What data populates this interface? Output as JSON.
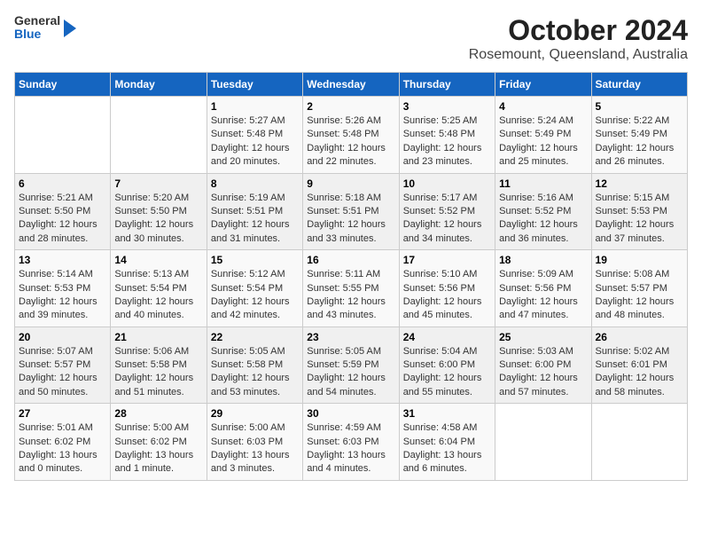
{
  "header": {
    "logo": {
      "general": "General",
      "blue": "Blue"
    },
    "title": "October 2024",
    "subtitle": "Rosemount, Queensland, Australia"
  },
  "weekdays": [
    "Sunday",
    "Monday",
    "Tuesday",
    "Wednesday",
    "Thursday",
    "Friday",
    "Saturday"
  ],
  "weeks": [
    [
      {
        "day": "",
        "info": ""
      },
      {
        "day": "",
        "info": ""
      },
      {
        "day": "1",
        "info": "Sunrise: 5:27 AM\nSunset: 5:48 PM\nDaylight: 12 hours and 20 minutes."
      },
      {
        "day": "2",
        "info": "Sunrise: 5:26 AM\nSunset: 5:48 PM\nDaylight: 12 hours and 22 minutes."
      },
      {
        "day": "3",
        "info": "Sunrise: 5:25 AM\nSunset: 5:48 PM\nDaylight: 12 hours and 23 minutes."
      },
      {
        "day": "4",
        "info": "Sunrise: 5:24 AM\nSunset: 5:49 PM\nDaylight: 12 hours and 25 minutes."
      },
      {
        "day": "5",
        "info": "Sunrise: 5:22 AM\nSunset: 5:49 PM\nDaylight: 12 hours and 26 minutes."
      }
    ],
    [
      {
        "day": "6",
        "info": "Sunrise: 5:21 AM\nSunset: 5:50 PM\nDaylight: 12 hours and 28 minutes."
      },
      {
        "day": "7",
        "info": "Sunrise: 5:20 AM\nSunset: 5:50 PM\nDaylight: 12 hours and 30 minutes."
      },
      {
        "day": "8",
        "info": "Sunrise: 5:19 AM\nSunset: 5:51 PM\nDaylight: 12 hours and 31 minutes."
      },
      {
        "day": "9",
        "info": "Sunrise: 5:18 AM\nSunset: 5:51 PM\nDaylight: 12 hours and 33 minutes."
      },
      {
        "day": "10",
        "info": "Sunrise: 5:17 AM\nSunset: 5:52 PM\nDaylight: 12 hours and 34 minutes."
      },
      {
        "day": "11",
        "info": "Sunrise: 5:16 AM\nSunset: 5:52 PM\nDaylight: 12 hours and 36 minutes."
      },
      {
        "day": "12",
        "info": "Sunrise: 5:15 AM\nSunset: 5:53 PM\nDaylight: 12 hours and 37 minutes."
      }
    ],
    [
      {
        "day": "13",
        "info": "Sunrise: 5:14 AM\nSunset: 5:53 PM\nDaylight: 12 hours and 39 minutes."
      },
      {
        "day": "14",
        "info": "Sunrise: 5:13 AM\nSunset: 5:54 PM\nDaylight: 12 hours and 40 minutes."
      },
      {
        "day": "15",
        "info": "Sunrise: 5:12 AM\nSunset: 5:54 PM\nDaylight: 12 hours and 42 minutes."
      },
      {
        "day": "16",
        "info": "Sunrise: 5:11 AM\nSunset: 5:55 PM\nDaylight: 12 hours and 43 minutes."
      },
      {
        "day": "17",
        "info": "Sunrise: 5:10 AM\nSunset: 5:56 PM\nDaylight: 12 hours and 45 minutes."
      },
      {
        "day": "18",
        "info": "Sunrise: 5:09 AM\nSunset: 5:56 PM\nDaylight: 12 hours and 47 minutes."
      },
      {
        "day": "19",
        "info": "Sunrise: 5:08 AM\nSunset: 5:57 PM\nDaylight: 12 hours and 48 minutes."
      }
    ],
    [
      {
        "day": "20",
        "info": "Sunrise: 5:07 AM\nSunset: 5:57 PM\nDaylight: 12 hours and 50 minutes."
      },
      {
        "day": "21",
        "info": "Sunrise: 5:06 AM\nSunset: 5:58 PM\nDaylight: 12 hours and 51 minutes."
      },
      {
        "day": "22",
        "info": "Sunrise: 5:05 AM\nSunset: 5:58 PM\nDaylight: 12 hours and 53 minutes."
      },
      {
        "day": "23",
        "info": "Sunrise: 5:05 AM\nSunset: 5:59 PM\nDaylight: 12 hours and 54 minutes."
      },
      {
        "day": "24",
        "info": "Sunrise: 5:04 AM\nSunset: 6:00 PM\nDaylight: 12 hours and 55 minutes."
      },
      {
        "day": "25",
        "info": "Sunrise: 5:03 AM\nSunset: 6:00 PM\nDaylight: 12 hours and 57 minutes."
      },
      {
        "day": "26",
        "info": "Sunrise: 5:02 AM\nSunset: 6:01 PM\nDaylight: 12 hours and 58 minutes."
      }
    ],
    [
      {
        "day": "27",
        "info": "Sunrise: 5:01 AM\nSunset: 6:02 PM\nDaylight: 13 hours and 0 minutes."
      },
      {
        "day": "28",
        "info": "Sunrise: 5:00 AM\nSunset: 6:02 PM\nDaylight: 13 hours and 1 minute."
      },
      {
        "day": "29",
        "info": "Sunrise: 5:00 AM\nSunset: 6:03 PM\nDaylight: 13 hours and 3 minutes."
      },
      {
        "day": "30",
        "info": "Sunrise: 4:59 AM\nSunset: 6:03 PM\nDaylight: 13 hours and 4 minutes."
      },
      {
        "day": "31",
        "info": "Sunrise: 4:58 AM\nSunset: 6:04 PM\nDaylight: 13 hours and 6 minutes."
      },
      {
        "day": "",
        "info": ""
      },
      {
        "day": "",
        "info": ""
      }
    ]
  ]
}
